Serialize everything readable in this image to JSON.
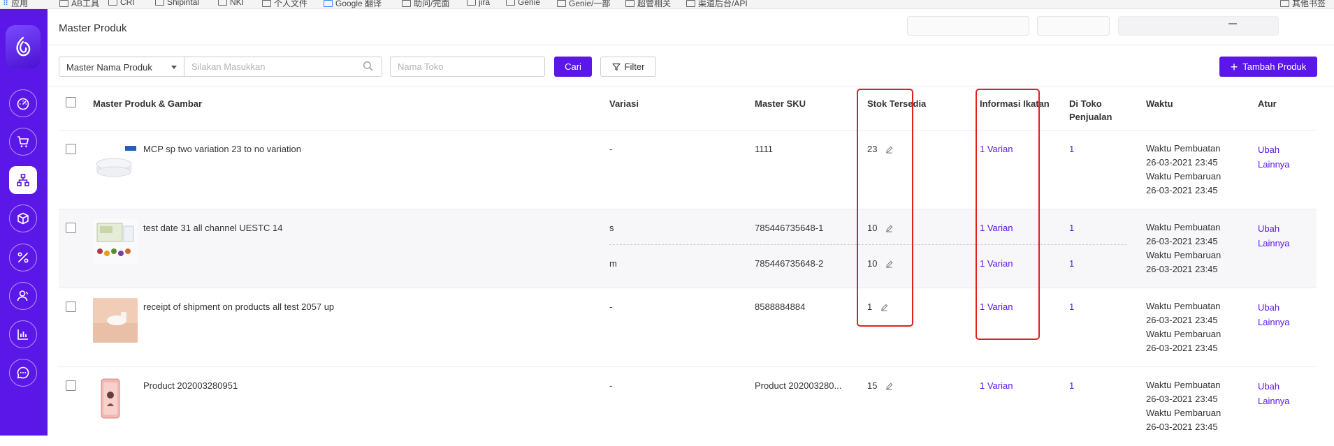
{
  "bookmarks": [
    "应用",
    "AB工具",
    "CRI",
    "Shipintal",
    "NKI",
    "个人文件",
    "Google 翻译",
    "助问/完面",
    "jira",
    "Genie",
    "Genie/一部",
    "超管相关",
    "渠道后台/API"
  ],
  "bookmarks_right": "其他书签",
  "header": {
    "title": "Master Produk"
  },
  "toolbar": {
    "select_value": "Master Nama Produk",
    "search_placeholder": "Silakan Masukkan",
    "toko_placeholder": "Nama Toko",
    "cari_label": "Cari",
    "filter_label": "Filter",
    "tambah_label": "Tambah Produk"
  },
  "columns": [
    "Master Produk & Gambar",
    "Variasi",
    "Master SKU",
    "Stok Tersedia",
    "Informasi Ikatan",
    "Di Toko Penjualan",
    "Waktu",
    "Atur"
  ],
  "rows": [
    {
      "name": "MCP sp two variation 23 to no variation",
      "variasi": "-",
      "sku": "1111",
      "stok": "23",
      "ikatan": "1 Varian",
      "toko": "1",
      "w1": "Waktu Pembuatan",
      "t1": "26-03-2021 23:45",
      "w2": "Waktu Pembaruan",
      "t2": "26-03-2021 23:45",
      "ubah": "Ubah",
      "lainnya": "Lainnya"
    },
    {
      "name": "test date 31 all channel UESTC 14",
      "variasi": "s",
      "sku": "785446735648-1",
      "stok": "10",
      "ikatan": "1 Varian",
      "toko": "1",
      "variasi2": "m",
      "sku2": "785446735648-2",
      "stok2": "10",
      "ikatan2": "1 Varian",
      "toko2": "1",
      "w1": "Waktu Pembuatan",
      "t1": "26-03-2021 23:45",
      "w2": "Waktu Pembaruan",
      "t2": "26-03-2021 23:45",
      "ubah": "Ubah",
      "lainnya": "Lainnya"
    },
    {
      "name": "receipt of shipment on products all test 2057 up",
      "variasi": "-",
      "sku": "8588884884",
      "stok": "1",
      "ikatan": "1 Varian",
      "toko": "1",
      "w1": "Waktu Pembuatan",
      "t1": "26-03-2021 23:45",
      "w2": "Waktu Pembaruan",
      "t2": "26-03-2021 23:45",
      "ubah": "Ubah",
      "lainnya": "Lainnya"
    },
    {
      "name": "Product 202003280951",
      "variasi": "-",
      "sku": "Product 202003280...",
      "stok": "15",
      "ikatan": "1 Varian",
      "toko": "1",
      "w1": "Waktu Pembuatan",
      "t1": "26-03-2021 23:45",
      "w2": "Waktu Pembaruan",
      "t2": "26-03-2021 23:45",
      "ubah": "Ubah",
      "lainnya": "Lainnya"
    }
  ],
  "colors": {
    "accent": "#5b17e8",
    "highlight": "#e02020"
  },
  "sidebar_icons": [
    "dashboard-icon",
    "cart-icon",
    "hierarchy-icon",
    "box-icon",
    "percent-icon",
    "users-icon",
    "bar-chart-icon",
    "chat-icon"
  ]
}
